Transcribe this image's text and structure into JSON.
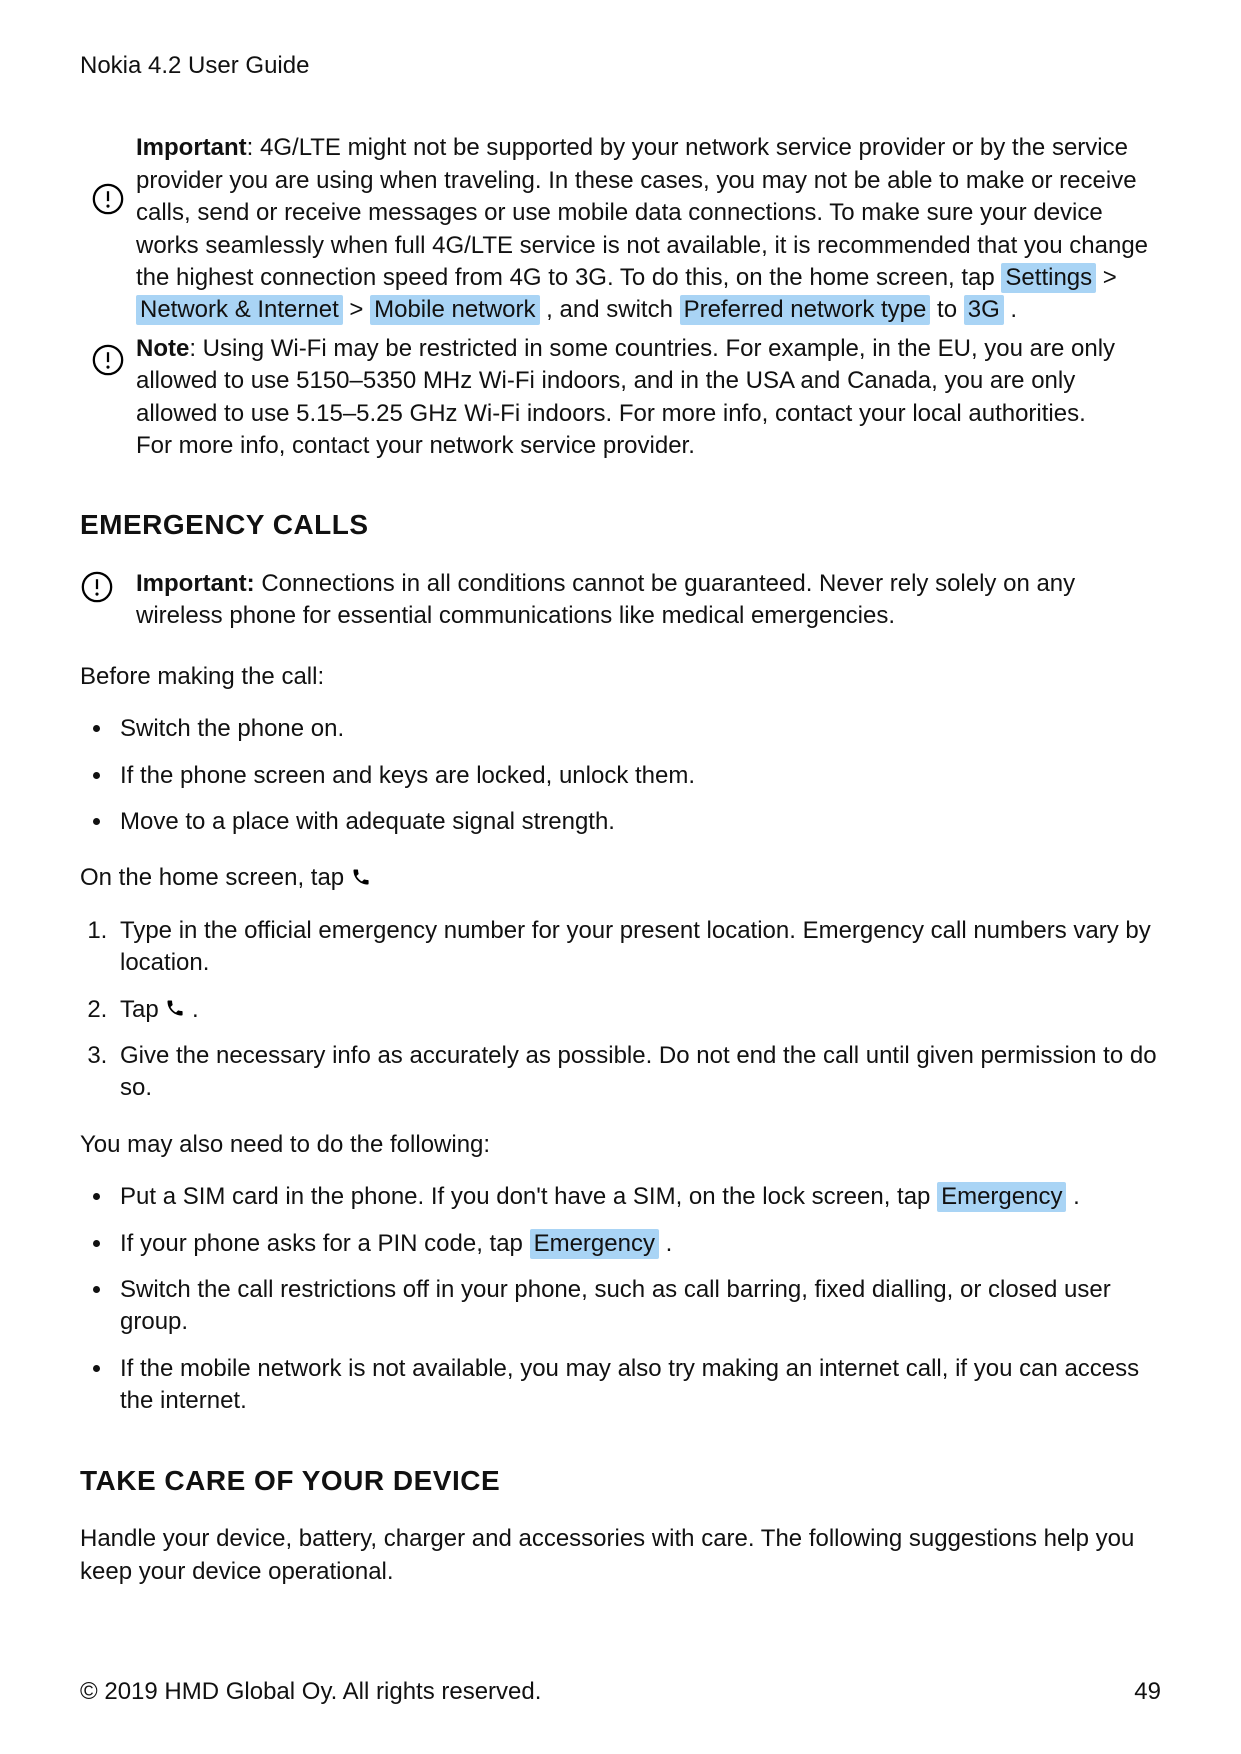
{
  "header": {
    "title": "Nokia 4.2 User Guide"
  },
  "important_note": {
    "label": "Important",
    "text_before": ": 4G/LTE might not be supported by your network service provider or by the service provider you are using when traveling. In these cases, you may not be able to make or receive calls, send or receive messages or use mobile data connections. To make sure your device works seamlessly when full 4G/LTE service is not available, it is recommended that you change the highest connection speed from 4G to 3G. To do this, on the home screen, tap ",
    "chip_settings": "Settings",
    "sep1": " > ",
    "chip_network_internet": "Network & Internet",
    "sep2": " > ",
    "chip_mobile_network": "Mobile network",
    "text_mid": " , and switch ",
    "chip_pref_net_type": "Preferred network type",
    "text_to": " to ",
    "chip_3g": "3G",
    "text_end": " ."
  },
  "wifi_note": {
    "label": "Note",
    "text1": ": Using Wi-Fi may be restricted in some countries. For example, in the EU, you are only allowed to use 5150–5350 MHz Wi-Fi indoors, and in the USA and Canada, you are only allowed to use 5.15–5.25 GHz Wi-Fi indoors. For more info, contact your local authorities.",
    "text2": "For more info, contact your network service provider."
  },
  "section_emergency": {
    "title": "EMERGENCY CALLS",
    "important_label": "Important:",
    "important_text": " Connections in all conditions cannot be guaranteed. Never rely solely on any wireless phone for essential communications like medical emergencies.",
    "before_call_intro": "Before making the call:",
    "before_list": [
      "Switch the phone on.",
      "If the phone screen and keys are locked, unlock them.",
      "Move to a place with adequate signal strength."
    ],
    "home_tap_prefix": "On the home screen, tap ",
    "steps": [
      "Type in the official emergency number for your present location. Emergency call numbers vary by location.",
      {
        "prefix": "Tap ",
        "suffix": "."
      },
      "Give the necessary info as accurately as possible. Do not end the call until given permission to do so."
    ],
    "also_intro": "You may also need to do the following:",
    "also_list": [
      {
        "prefix": "Put a SIM card in the phone. If you don't have a SIM, on the lock screen, tap ",
        "chip": "Emergency",
        "suffix": " ."
      },
      {
        "prefix": "If your phone asks for a PIN code, tap ",
        "chip": "Emergency",
        "suffix": " ."
      },
      "Switch the call restrictions off in your phone, such as call barring, fixed dialling, or closed user group.",
      "If the mobile network is not available, you may also try making an internet call, if you can access the internet."
    ]
  },
  "section_care": {
    "title": "TAKE CARE OF YOUR DEVICE",
    "para": "Handle your device, battery, charger and accessories with care. The following suggestions help you keep your device operational."
  },
  "footer": {
    "copyright": "© 2019 HMD Global Oy. All rights reserved.",
    "page": "49"
  }
}
